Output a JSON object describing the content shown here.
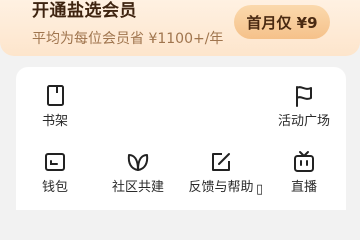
{
  "vip_banner": {
    "title": "开通盐选会员",
    "subtitle": "平均为每位会员省 ¥1100+/年",
    "cta_label": "首月仅 ¥9"
  },
  "menu": {
    "items": [
      {
        "label": "书架",
        "icon": "bookshelf-icon"
      },
      {
        "label": "活动广场",
        "icon": "flag-icon"
      },
      {
        "label": "钱包",
        "icon": "wallet-icon"
      },
      {
        "label": "社区共建",
        "icon": "community-icon"
      },
      {
        "label": "反馈与帮助",
        "icon": "feedback-icon"
      },
      {
        "label": "直播",
        "icon": "live-tv-icon"
      }
    ]
  },
  "colors": {
    "banner_bg": "#fde5cc",
    "banner_title": "#3f2410",
    "banner_subtitle": "#a0754e",
    "cta_bg": "#f5c18a",
    "page_bg": "#f2f2f2",
    "card_bg": "#ffffff",
    "icon_stroke": "#222222"
  }
}
